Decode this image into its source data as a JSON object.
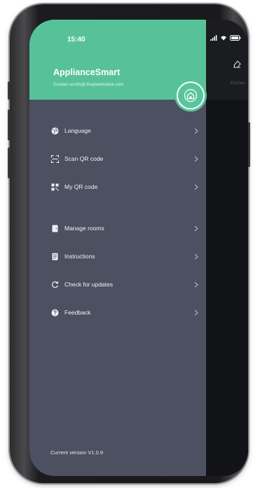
{
  "status_bar": {
    "time": "15:40"
  },
  "drawer": {
    "app_name": "ApplianceSmart",
    "contact": "Contact us:info@.ltsuperemotion.com",
    "menu_items": [
      {
        "label": "Language",
        "icon": "globe-icon"
      },
      {
        "label": "Scan QR code",
        "icon": "scan-icon"
      },
      {
        "label": "My QR code",
        "icon": "qr-code-icon"
      },
      {
        "label": "Manage rooms",
        "icon": "door-icon"
      },
      {
        "label": "Instructions",
        "icon": "book-icon"
      },
      {
        "label": "Check for updates",
        "icon": "refresh-icon"
      },
      {
        "label": "Feedback",
        "icon": "question-icon"
      }
    ],
    "version": "Current version V1.0.9"
  },
  "background_screen": {
    "header_text": "Kitchen"
  },
  "colors": {
    "header_green": "#57c29a",
    "drawer_bg": "#4c5061",
    "backdrop": "#121317"
  }
}
